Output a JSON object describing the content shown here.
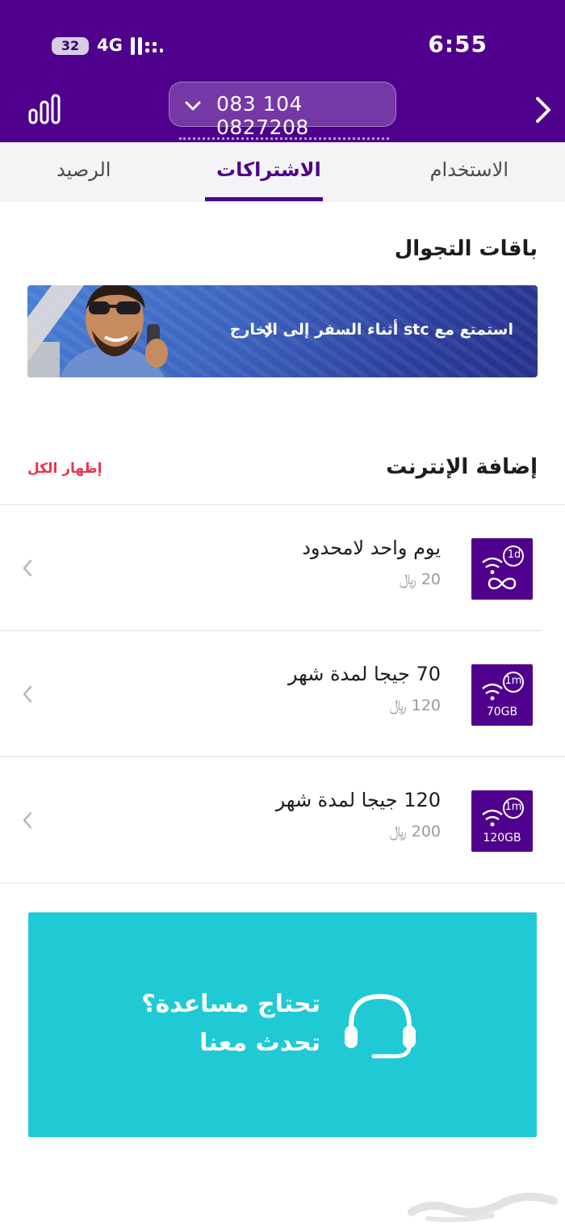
{
  "status_bar": {
    "time": "6:55",
    "battery": "32",
    "network": "4G"
  },
  "header": {
    "phone_number": "083 104 0827208"
  },
  "tabs": [
    {
      "label": "الاستخدام"
    },
    {
      "label": "الاشتراكات",
      "active": true
    },
    {
      "label": "الرصيد"
    }
  ],
  "roaming": {
    "title": "باقات التجوال",
    "banner_text": "استمتع مع stc أثناء السفر إلى الخارج"
  },
  "internet_addons": {
    "title": "إضافة الإنترنت",
    "show_all": "إظهار الكل",
    "items": [
      {
        "name": "يوم واحد لامحدود",
        "price": "20 ﷼",
        "badge": "1d",
        "icon": "infinity-icon",
        "caption": ""
      },
      {
        "name": "70 جيجا لمدة شهر",
        "price": "120 ﷼",
        "badge": "1m",
        "icon": "wifi-icon",
        "caption": "70GB"
      },
      {
        "name": "120 جيجا لمدة شهر",
        "price": "200 ﷼",
        "badge": "1m",
        "icon": "wifi-icon",
        "caption": "120GB"
      }
    ]
  },
  "help": {
    "line1": "تحتاج مساعدة؟",
    "line2": "تحدث معنا",
    "icon": "headset-icon"
  },
  "colors": {
    "brand": "#4f008c",
    "accent_red": "#e8344e",
    "help_bg": "#1fcad5"
  }
}
